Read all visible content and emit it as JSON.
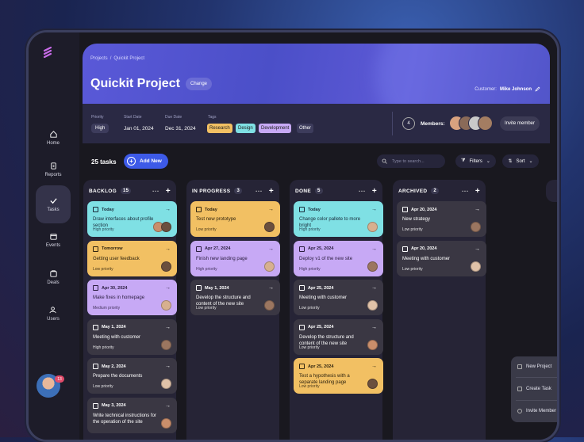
{
  "sidebar": {
    "items": [
      {
        "label": "Home",
        "icon": "home-icon"
      },
      {
        "label": "Reports",
        "icon": "clipboard-icon"
      },
      {
        "label": "Tasks",
        "icon": "check-icon",
        "active": true
      },
      {
        "label": "Events",
        "icon": "calendar-icon"
      },
      {
        "label": "Deals",
        "icon": "folder-icon"
      },
      {
        "label": "Users",
        "icon": "users-icon"
      }
    ],
    "notif_count": "13"
  },
  "header": {
    "crumb1": "Projects",
    "crumb2": "Quickit Project",
    "title": "Quickit Project",
    "change": "Change",
    "customer_label": "Customer:",
    "customer_name": "Mike Johnson"
  },
  "meta": {
    "priority_label": "Priority",
    "priority": "High",
    "start_label": "Start Date",
    "start": "Jan 01, 2024",
    "due_label": "Due Date",
    "due": "Dec 31, 2024",
    "tags_label": "Tags",
    "tags": [
      "Research",
      "Design",
      "Development",
      "Other"
    ],
    "members_count": "4",
    "members_label": "Members:",
    "invite": "Invite member"
  },
  "toolbar": {
    "task_count": "25 tasks",
    "add_new": "Add New",
    "search_placeholder": "Type to search...",
    "filters": "Filters",
    "sort": "Sort"
  },
  "columns": [
    {
      "name": "BACKLOG",
      "count": "15",
      "cards": [
        {
          "date": "Today",
          "title": "Draw interfaces about profile section",
          "priority": "High priority",
          "color": "cyan"
        },
        {
          "date": "Tomorrow",
          "title": "Getting user feedback",
          "priority": "Low priority",
          "color": "orange"
        },
        {
          "date": "Apr 30, 2024",
          "title": "Make fixes in homepage",
          "priority": "Medium priority",
          "color": "purple"
        },
        {
          "date": "May 1, 2024",
          "title": "Meeting with customer",
          "priority": "High priority",
          "color": "dark"
        },
        {
          "date": "May 2, 2024",
          "title": "Prepare the documents",
          "priority": "Low priority",
          "color": "dark"
        },
        {
          "date": "May 3, 2024",
          "title": "Write technical instructions for the operation of the site",
          "priority": "",
          "color": "dark"
        }
      ]
    },
    {
      "name": "IN PROGRESS",
      "count": "3",
      "cards": [
        {
          "date": "Today",
          "title": "Test new prototype",
          "priority": "Low priority",
          "color": "orange"
        },
        {
          "date": "Apr 27, 2024",
          "title": "Finish new landing page",
          "priority": "High priority",
          "color": "purple"
        },
        {
          "date": "May 1, 2024",
          "title": "Develop the structure and content of the new site",
          "priority": "Low priority",
          "color": "dark"
        }
      ]
    },
    {
      "name": "DONE",
      "count": "5",
      "cards": [
        {
          "date": "Today",
          "title": "Change color pallete to more bright",
          "priority": "High priority",
          "color": "cyan"
        },
        {
          "date": "Apr 25, 2024",
          "title": "Deploy v1 of the new site",
          "priority": "High priority",
          "color": "purple"
        },
        {
          "date": "Apr 25, 2024",
          "title": "Meeting with customer",
          "priority": "Low priority",
          "color": "dark"
        },
        {
          "date": "Apr 25, 2024",
          "title": "Develop the structure and content of the new site",
          "priority": "Low priority",
          "color": "dark"
        },
        {
          "date": "Apr 25, 2024",
          "title": "Test a hypothesis with a separate landing page",
          "priority": "Low priority",
          "color": "orange"
        }
      ]
    },
    {
      "name": "ARCHIVED",
      "count": "2",
      "cards": [
        {
          "date": "Apr 20, 2024",
          "title": "New strategy",
          "priority": "Low priority",
          "color": "dark"
        },
        {
          "date": "Apr 20, 2024",
          "title": "Meeting with customer",
          "priority": "Low priority",
          "color": "dark"
        }
      ]
    }
  ],
  "popup": {
    "items": [
      "New Project",
      "Create Task",
      "Invite Member"
    ]
  },
  "colors": {
    "accent": "#3d5ae8",
    "cyan": "#7fe0e4",
    "orange": "#f2c063",
    "purple": "#c7a9f5",
    "dark": "#3a3743"
  }
}
